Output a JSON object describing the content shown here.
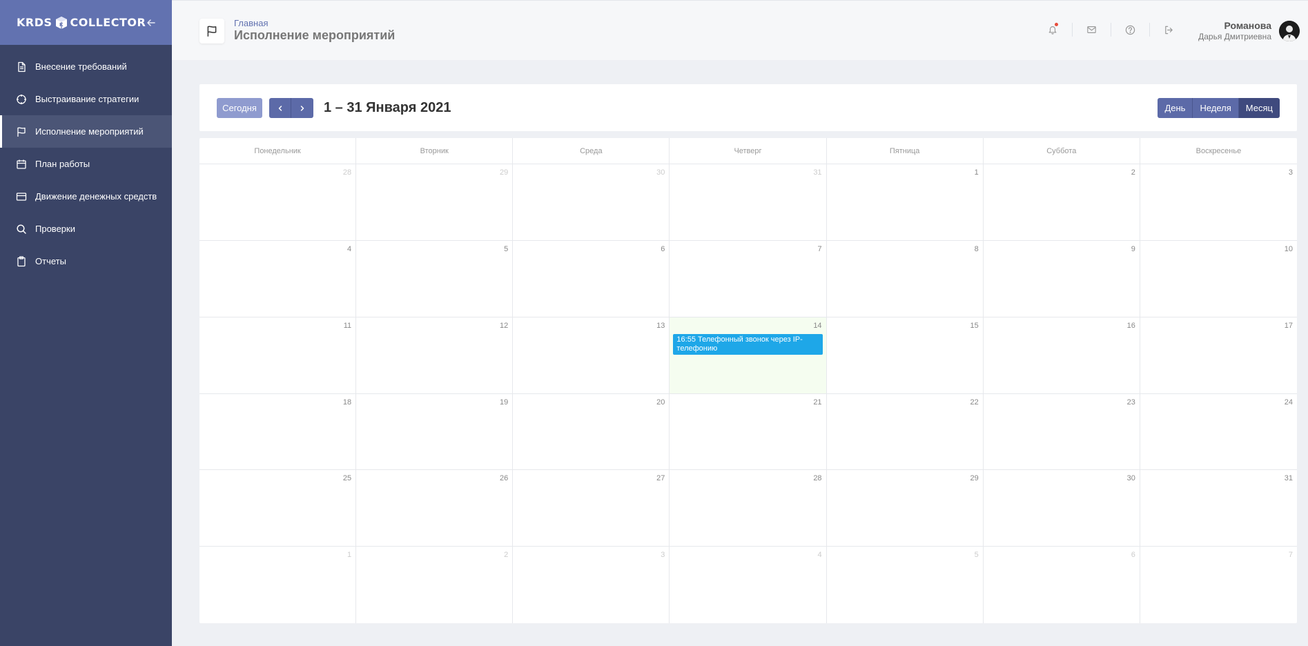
{
  "sidebar": {
    "logo_left": "KRDS",
    "logo_right": "COLLECTOR",
    "items": [
      {
        "label": "Внесение требований",
        "icon": "document-icon"
      },
      {
        "label": "Выстраивание стратегии",
        "icon": "crosshair-icon"
      },
      {
        "label": "Исполнение мероприятий",
        "icon": "flag-icon",
        "active": true
      },
      {
        "label": "План работы",
        "icon": "calendar-icon"
      },
      {
        "label": "Движение денежных средств",
        "icon": "credit-card-icon"
      },
      {
        "label": "Проверки",
        "icon": "search-icon"
      },
      {
        "label": "Отчеты",
        "icon": "clipboard-icon"
      }
    ]
  },
  "header": {
    "breadcrumb": "Главная",
    "title": "Исполнение мероприятий",
    "user_last_name": "Романова",
    "user_first_name": "Дарья Дмитриевна"
  },
  "toolbar": {
    "today_label": "Сегодня",
    "range_title": "1 – 31 Января 2021",
    "views": [
      "День",
      "Неделя",
      "Месяц"
    ],
    "active_view": "Месяц"
  },
  "calendar": {
    "weekdays": [
      "Понедельник",
      "Вторник",
      "Среда",
      "Четверг",
      "Пятница",
      "Суббота",
      "Воскресенье"
    ],
    "days": [
      {
        "n": "28",
        "other": true
      },
      {
        "n": "29",
        "other": true
      },
      {
        "n": "30",
        "other": true
      },
      {
        "n": "31",
        "other": true
      },
      {
        "n": "1"
      },
      {
        "n": "2"
      },
      {
        "n": "3"
      },
      {
        "n": "4"
      },
      {
        "n": "5"
      },
      {
        "n": "6"
      },
      {
        "n": "7"
      },
      {
        "n": "8"
      },
      {
        "n": "9"
      },
      {
        "n": "10"
      },
      {
        "n": "11"
      },
      {
        "n": "12"
      },
      {
        "n": "13"
      },
      {
        "n": "14",
        "today": true,
        "event": "16:55 Телефонный звонок через IP-телефонию"
      },
      {
        "n": "15"
      },
      {
        "n": "16"
      },
      {
        "n": "17"
      },
      {
        "n": "18"
      },
      {
        "n": "19"
      },
      {
        "n": "20"
      },
      {
        "n": "21"
      },
      {
        "n": "22"
      },
      {
        "n": "23"
      },
      {
        "n": "24"
      },
      {
        "n": "25"
      },
      {
        "n": "26"
      },
      {
        "n": "27"
      },
      {
        "n": "28"
      },
      {
        "n": "29"
      },
      {
        "n": "30"
      },
      {
        "n": "31"
      },
      {
        "n": "1",
        "other": true
      },
      {
        "n": "2",
        "other": true
      },
      {
        "n": "3",
        "other": true
      },
      {
        "n": "4",
        "other": true
      },
      {
        "n": "5",
        "other": true
      },
      {
        "n": "6",
        "other": true
      },
      {
        "n": "7",
        "other": true
      }
    ]
  },
  "colors": {
    "sidebar_bg": "#3a4466",
    "brand_bg": "#6272b0",
    "accent": "#5c6aa8",
    "event": "#1ea7e8",
    "today_bg": "#f5fdf0"
  }
}
